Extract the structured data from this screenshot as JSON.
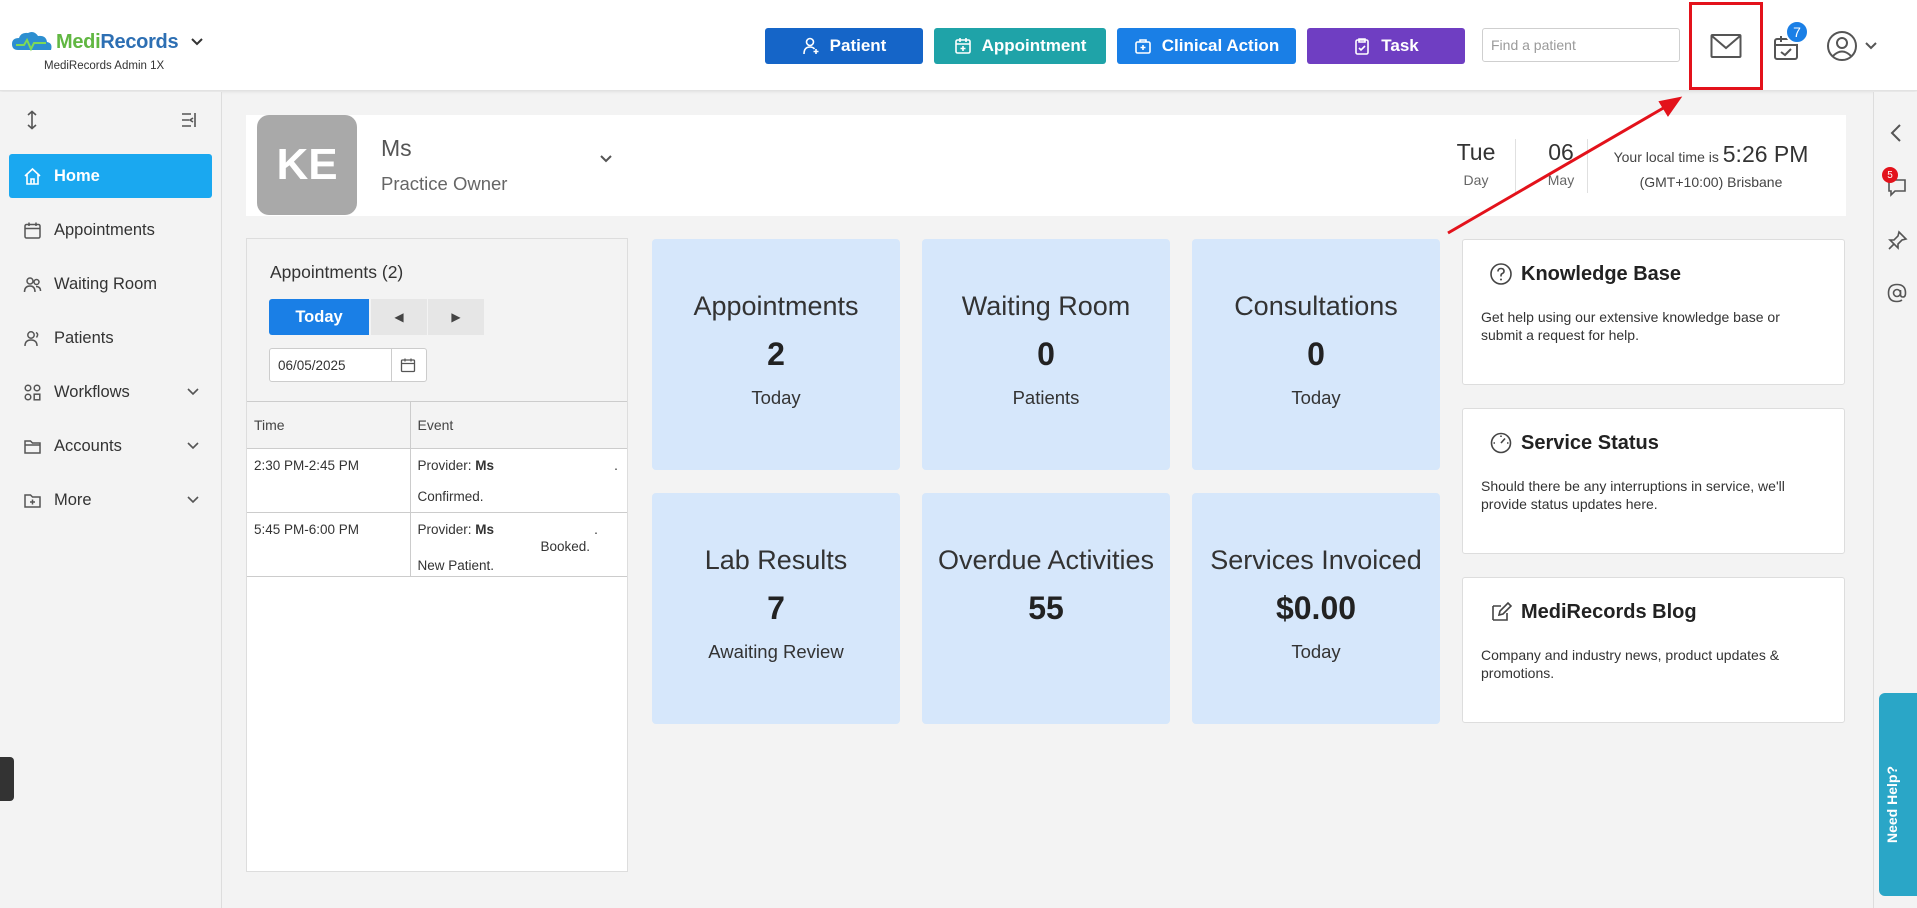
{
  "app": {
    "logo_text_a": "Medi",
    "logo_text_b": "Records",
    "subtitle": "MediRecords Admin 1X"
  },
  "header": {
    "buttons": [
      {
        "label": "Patient",
        "color": "#1565c8"
      },
      {
        "label": "Appointment",
        "color": "#1fa3a8"
      },
      {
        "label": "Clinical Action",
        "color": "#1a7fe6"
      },
      {
        "label": "Task",
        "color": "#6f3ec2"
      }
    ],
    "search_placeholder": "Find a patient",
    "calendar_badge": "7"
  },
  "sidebar": {
    "items": [
      {
        "label": "Home",
        "icon": "home-icon",
        "active": true
      },
      {
        "label": "Appointments",
        "icon": "calendar-icon"
      },
      {
        "label": "Waiting Room",
        "icon": "users-icon"
      },
      {
        "label": "Patients",
        "icon": "patients-icon"
      },
      {
        "label": "Workflows",
        "icon": "workflow-icon",
        "expandable": true
      },
      {
        "label": "Accounts",
        "icon": "folder-icon",
        "expandable": true
      },
      {
        "label": "More",
        "icon": "more-icon",
        "expandable": true
      }
    ]
  },
  "profile": {
    "initials": "KE",
    "name": "Ms",
    "role": "Practice Owner",
    "day_value": "Tue",
    "day_label": "Day",
    "date_value": "06",
    "date_label": "May",
    "local_time_prefix": "Your local time is",
    "local_time": "5:26 PM",
    "timezone": "(GMT+10:00) Brisbane"
  },
  "appointments_panel": {
    "title": "Appointments (2)",
    "today_label": "Today",
    "prev_label": "◀",
    "next_label": "▶",
    "date": "06/05/2025",
    "columns": [
      "Time",
      "Event"
    ],
    "rows": [
      {
        "time": "2:30 PM-2:45 PM",
        "provider_label": "Provider:",
        "provider": "Ms",
        "mark": ".",
        "status": "Confirmed."
      },
      {
        "time": "5:45 PM-6:00 PM",
        "provider_label": "Provider:",
        "provider": "Ms",
        "mark": ".",
        "status": "Booked.",
        "extra": "New Patient."
      }
    ]
  },
  "stats": [
    {
      "title": "Appointments",
      "value": "2",
      "sub": "Today"
    },
    {
      "title": "Waiting Room",
      "value": "0",
      "sub": "Patients"
    },
    {
      "title": "Consultations",
      "value": "0",
      "sub": "Today"
    },
    {
      "title": "Lab Results",
      "value": "7",
      "sub": "Awaiting Review"
    },
    {
      "title": "Overdue Activities",
      "value": "55",
      "sub": ""
    },
    {
      "title": "Services Invoiced",
      "value": "$0.00",
      "sub": "Today"
    }
  ],
  "info_cards": [
    {
      "title": "Knowledge Base",
      "icon": "question-icon",
      "body": "Get help using our extensive knowledge base or submit a request for help."
    },
    {
      "title": "Service Status",
      "icon": "gauge-icon",
      "body": "Should there be any interruptions in service, we'll provide status updates here."
    },
    {
      "title": "MediRecords Blog",
      "icon": "edit-icon",
      "body": "Company and industry news, product updates & promotions."
    }
  ],
  "rail": {
    "chat_badge": "5",
    "need_help": "Need Help?"
  },
  "colors": {
    "accent": "#1aa8f0",
    "highlight_red": "#e3121b",
    "card_bg": "#d6e7fb"
  }
}
